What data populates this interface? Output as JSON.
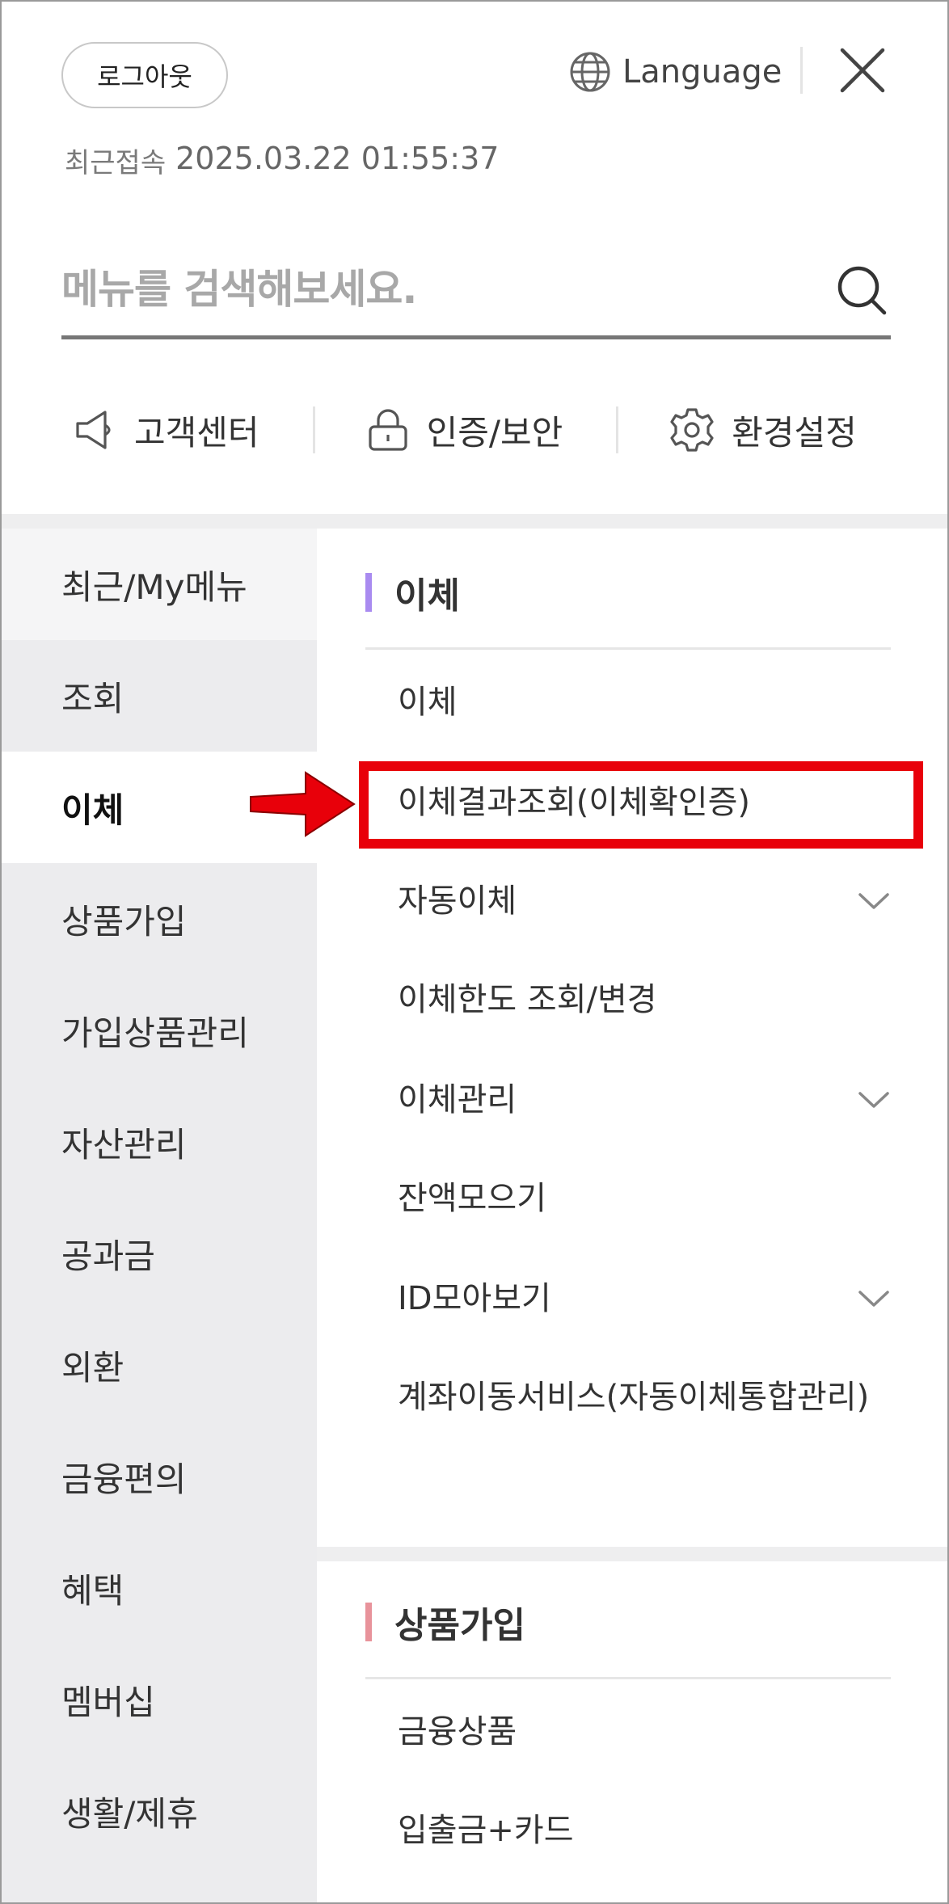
{
  "header": {
    "logout_label": "로그아웃",
    "language_label": "Language",
    "recent_label": "최근접속",
    "recent_time": "2025.03.22 01:55:37"
  },
  "search": {
    "placeholder": "메뉴를 검색해보세요."
  },
  "quick": [
    {
      "label": "고객센터",
      "icon": "megaphone-icon"
    },
    {
      "label": "인증/보안",
      "icon": "lock-icon"
    },
    {
      "label": "환경설정",
      "icon": "gear-icon"
    }
  ],
  "left_menu": [
    "최근/My메뉴",
    "조회",
    "이체",
    "상품가입",
    "가입상품관리",
    "자산관리",
    "공과금",
    "외환",
    "금융편의",
    "혜택",
    "멤버십",
    "생활/제휴"
  ],
  "active_left": "이체",
  "sections": [
    {
      "title": "이체",
      "accent": "#a98bf0",
      "items": [
        {
          "label": "이체",
          "expandable": false
        },
        {
          "label": "이체결과조회(이체확인증)",
          "expandable": false,
          "highlighted": true
        },
        {
          "label": "자동이체",
          "expandable": true
        },
        {
          "label": "이체한도 조회/변경",
          "expandable": false
        },
        {
          "label": "이체관리",
          "expandable": true
        },
        {
          "label": "잔액모으기",
          "expandable": false
        },
        {
          "label": "ID모아보기",
          "expandable": true
        },
        {
          "label": "계좌이동서비스(자동이체통합관리)",
          "expandable": false
        }
      ]
    },
    {
      "title": "상품가입",
      "accent": "#e8939b",
      "items": [
        {
          "label": "금융상품",
          "expandable": false
        },
        {
          "label": "입출금+카드",
          "expandable": false
        }
      ]
    }
  ],
  "annotation_color": "#e8000a"
}
